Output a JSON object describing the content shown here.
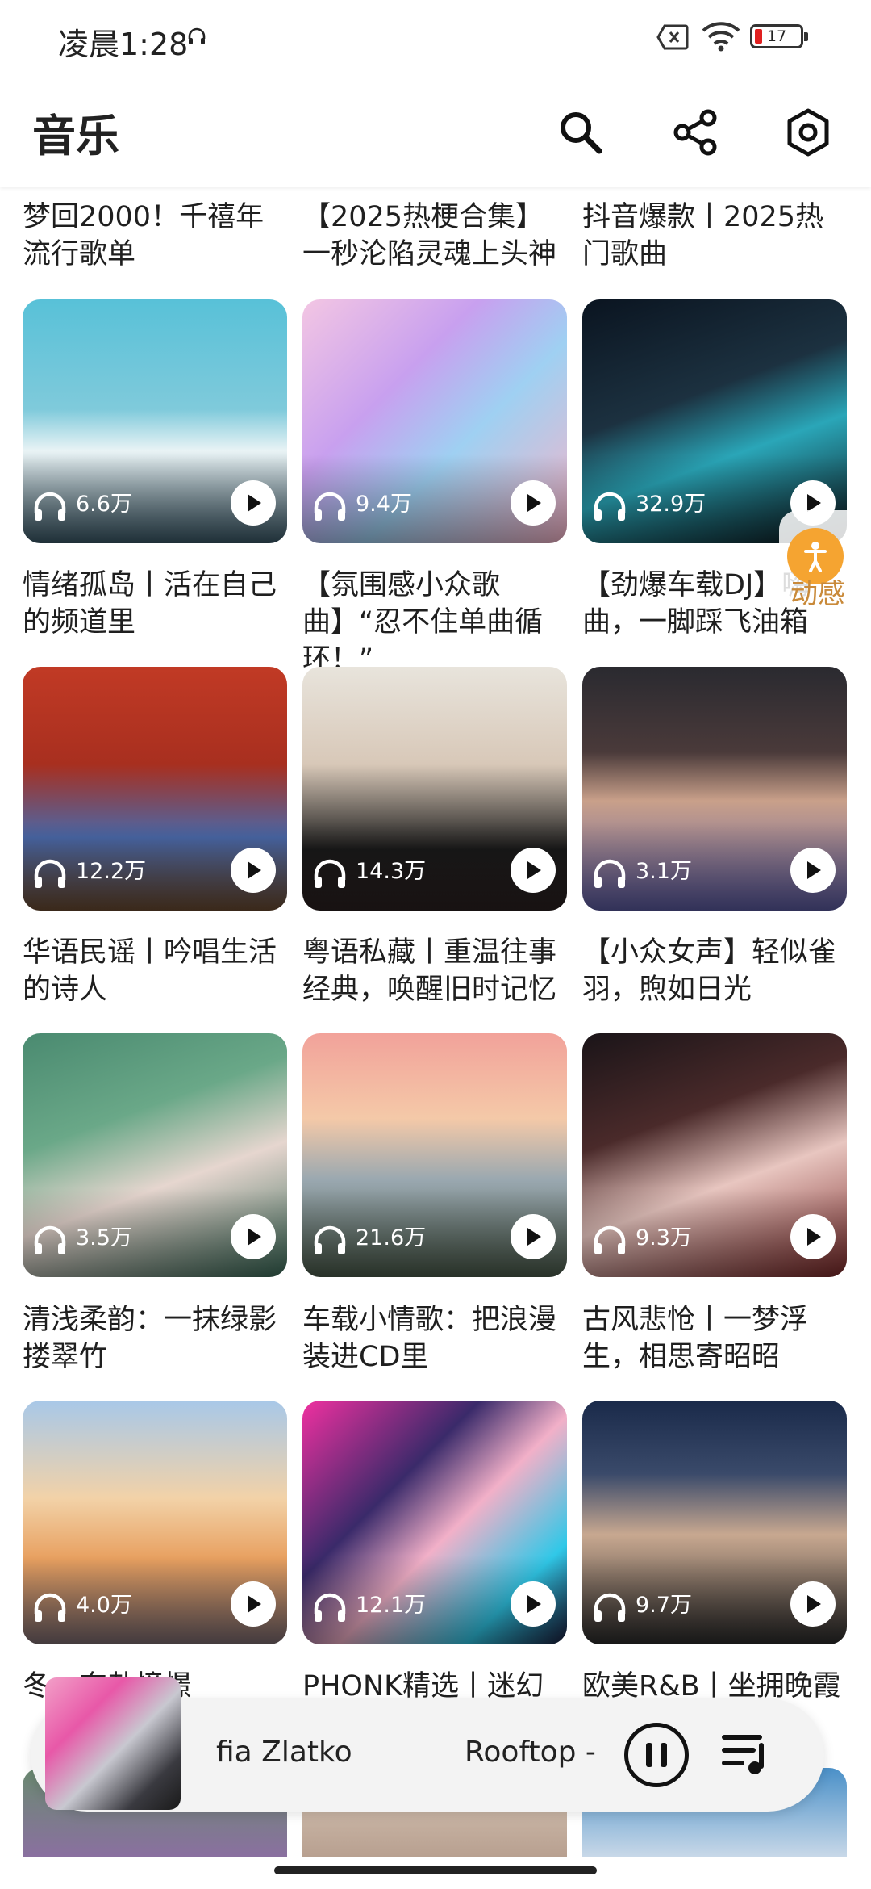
{
  "status_bar": {
    "time": "凌晨1:28",
    "battery": "17"
  },
  "header": {
    "title": "音乐"
  },
  "top_captions": [
    "梦回2000！千禧年流行歌单",
    "【2025热梗合集】一秒沦陷灵魂上头神",
    "抖音爆款丨2025热门歌曲"
  ],
  "playlists": [
    {
      "plays": "6.6万",
      "title": "情绪孤岛丨活在自己的频道里"
    },
    {
      "plays": "9.4万",
      "title": "【氛围感小众歌曲】“忍不住单曲循环！”"
    },
    {
      "plays": "32.9万",
      "title": "【劲爆车载DJ】嗨曲，一脚踩飞油箱"
    },
    {
      "plays": "12.2万",
      "title": "华语民谣丨吟唱生活的诗人"
    },
    {
      "plays": "14.3万",
      "title": "粤语私藏丨重温往事经典，唤醒旧时记忆"
    },
    {
      "plays": "3.1万",
      "title": "【小众女声】轻似雀羽，煦如日光"
    },
    {
      "plays": "3.5万",
      "title": "清浅柔韵：一抹绿影搂翠竹"
    },
    {
      "plays": "21.6万",
      "title": "车载小情歌：把浪漫装进CD里"
    },
    {
      "plays": "9.3万",
      "title": "古风悲怆丨一梦浮生，相思寄昭昭"
    },
    {
      "plays": "4.0万",
      "title": "冬…奔赴憧憬"
    },
    {
      "plays": "12.1万",
      "title": "PHONK精选丨迷幻"
    },
    {
      "plays": "9.7万",
      "title": "欧美R&B丨坐拥晚霞"
    }
  ],
  "floating": {
    "label": "动感"
  },
  "player": {
    "artist": "fia Zlatko",
    "song": "Rooftop -"
  },
  "colors": {
    "accent": "#f5a431",
    "text": "#1f1f1f"
  }
}
